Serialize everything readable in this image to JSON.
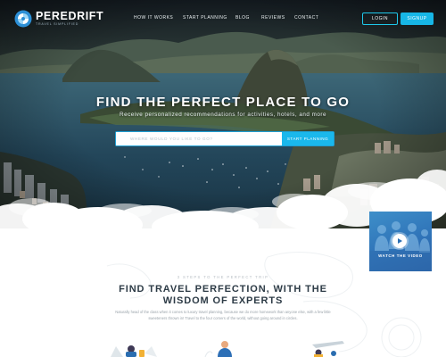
{
  "brand": {
    "name": "PEREDRIFT",
    "tagline": "TRAVEL SIMPLIFIED",
    "accent": "#17b6e6"
  },
  "nav": {
    "items": [
      "HOW IT WORKS",
      "START PLANNING",
      "BLOG",
      "REVIEWS",
      "CONTACT"
    ],
    "login_label": "LOGIN",
    "signup_label": "SIGNUP"
  },
  "hero": {
    "title": "FIND THE PERFECT PLACE TO GO",
    "subtitle": "Receive personalized recommendations for activities, hotels, and more",
    "search_placeholder": "WHERE WOULD YOU LIKE TO GO?",
    "search_button": "START PLANNING"
  },
  "video": {
    "label": "WATCH THE VIDEO",
    "icon": "play-icon"
  },
  "steps": {
    "label": "3 STEPS TO THE PERFECT TRIP",
    "title": "FIND TRAVEL PERFECTION, WITH THE WISDOM OF EXPERTS",
    "body": "Naturally head of the class when it comes to luxury travel planning, because we do more homework than anyone else, with a few little sweeteners thrown in! Travel to the four corners of the world, without going around in circles."
  },
  "icons": [
    "logo-mark-icon",
    "play-icon",
    "suitcase-icon",
    "person-icon",
    "airplane-icon"
  ]
}
